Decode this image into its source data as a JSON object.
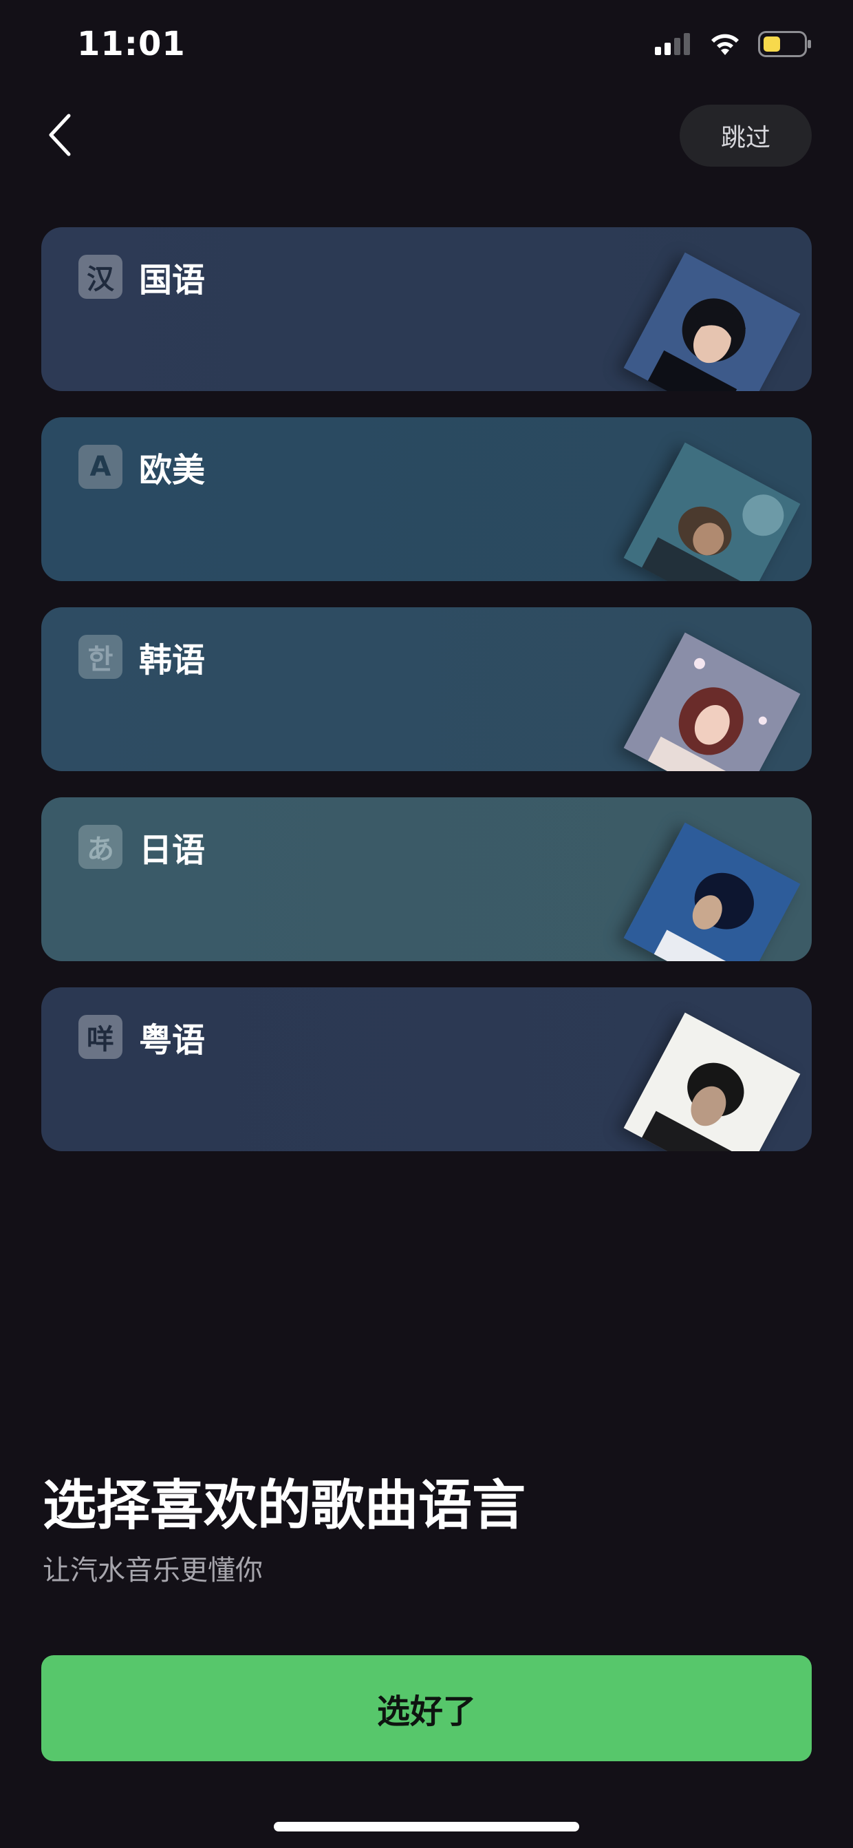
{
  "status_bar": {
    "time": "11:01",
    "icons": [
      "cellular-signal-icon",
      "wifi-icon",
      "battery-icon"
    ],
    "battery_color": "#f7d94c"
  },
  "nav": {
    "back_icon": "chevron-left-icon",
    "skip_label": "跳过"
  },
  "languages": [
    {
      "badge": "汉",
      "label": "国语",
      "card_color": "#2b3852",
      "badge_bg": "#6b7486",
      "badge_fg": "#1f2a3d",
      "art_icon": "female-singer-cover-art"
    },
    {
      "badge": "A",
      "label": "欧美",
      "card_color": "#2a4a60",
      "badge_bg": "#5f7383",
      "badge_fg": "#213b4f",
      "art_icon": "male-singer-cover-art"
    },
    {
      "badge": "한",
      "label": "韩语",
      "card_color": "#2e4c62",
      "badge_bg": "#5f7786",
      "badge_fg": "#7f93a0",
      "art_icon": "female-singer-cover-art"
    },
    {
      "badge": "あ",
      "label": "日语",
      "card_color": "#3a5a67",
      "badge_bg": "#66808a",
      "badge_fg": "#90a6ad",
      "art_icon": "male-singer-cover-art"
    },
    {
      "badge": "咩",
      "label": "粤语",
      "card_color": "#2b3852",
      "badge_bg": "#6b7486",
      "badge_fg": "#1f2a3d",
      "art_icon": "male-singer-cover-art"
    }
  ],
  "main": {
    "title": "选择喜欢的歌曲语言",
    "subtitle": "让汽水音乐更懂你",
    "confirm_label": "选好了"
  },
  "colors": {
    "background": "#131017",
    "accent": "#57c76b"
  }
}
